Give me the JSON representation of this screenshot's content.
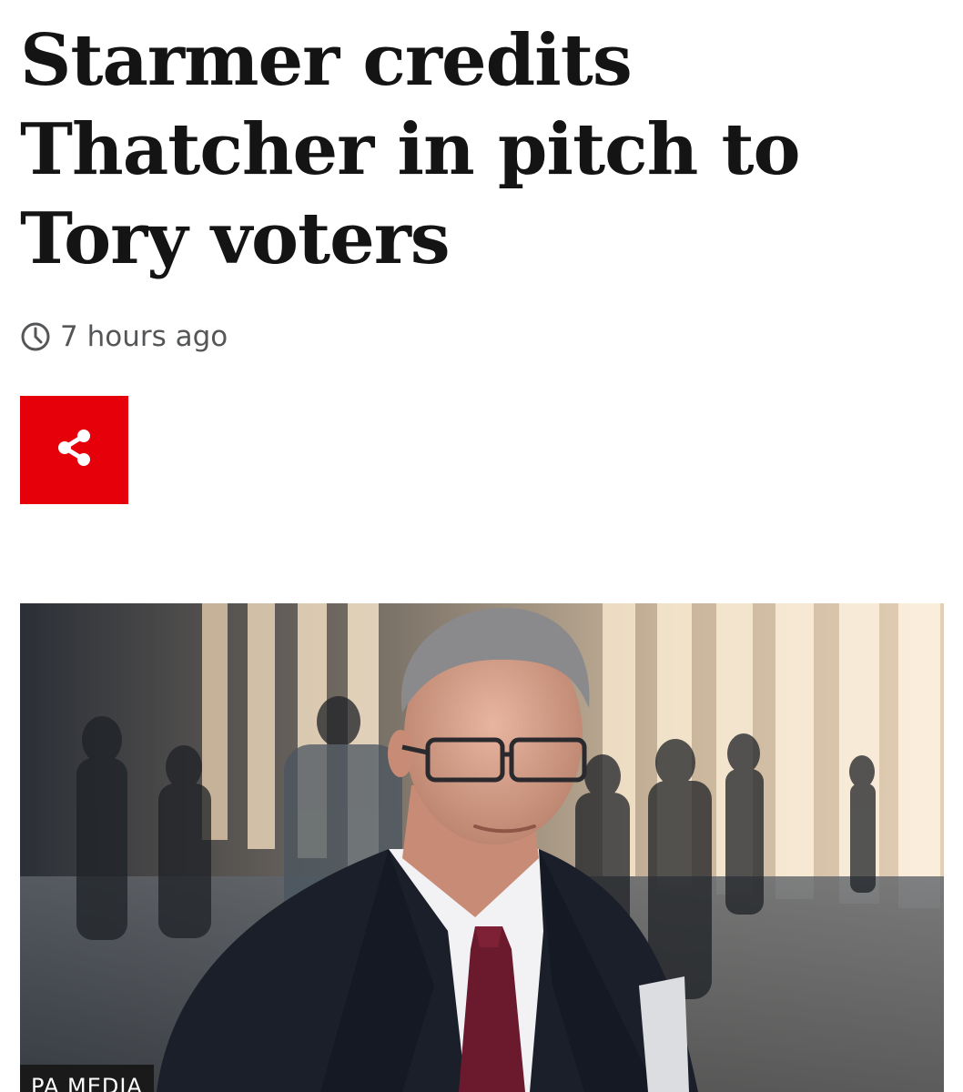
{
  "article": {
    "headline_lines": [
      "Starmer credits",
      "Thatcher in pitch to",
      "Tory voters"
    ],
    "timestamp": "7 hours ago",
    "timestamp_icon": "clock-icon",
    "share_icon": "share-icon",
    "image_alt": "Keir Starmer in a dark suit walking through a crowd in front of illuminated columns",
    "image_credit": "PA MEDIA"
  },
  "colors": {
    "accent": "#e6000a",
    "headline": "#141414",
    "meta_text": "#545658"
  }
}
